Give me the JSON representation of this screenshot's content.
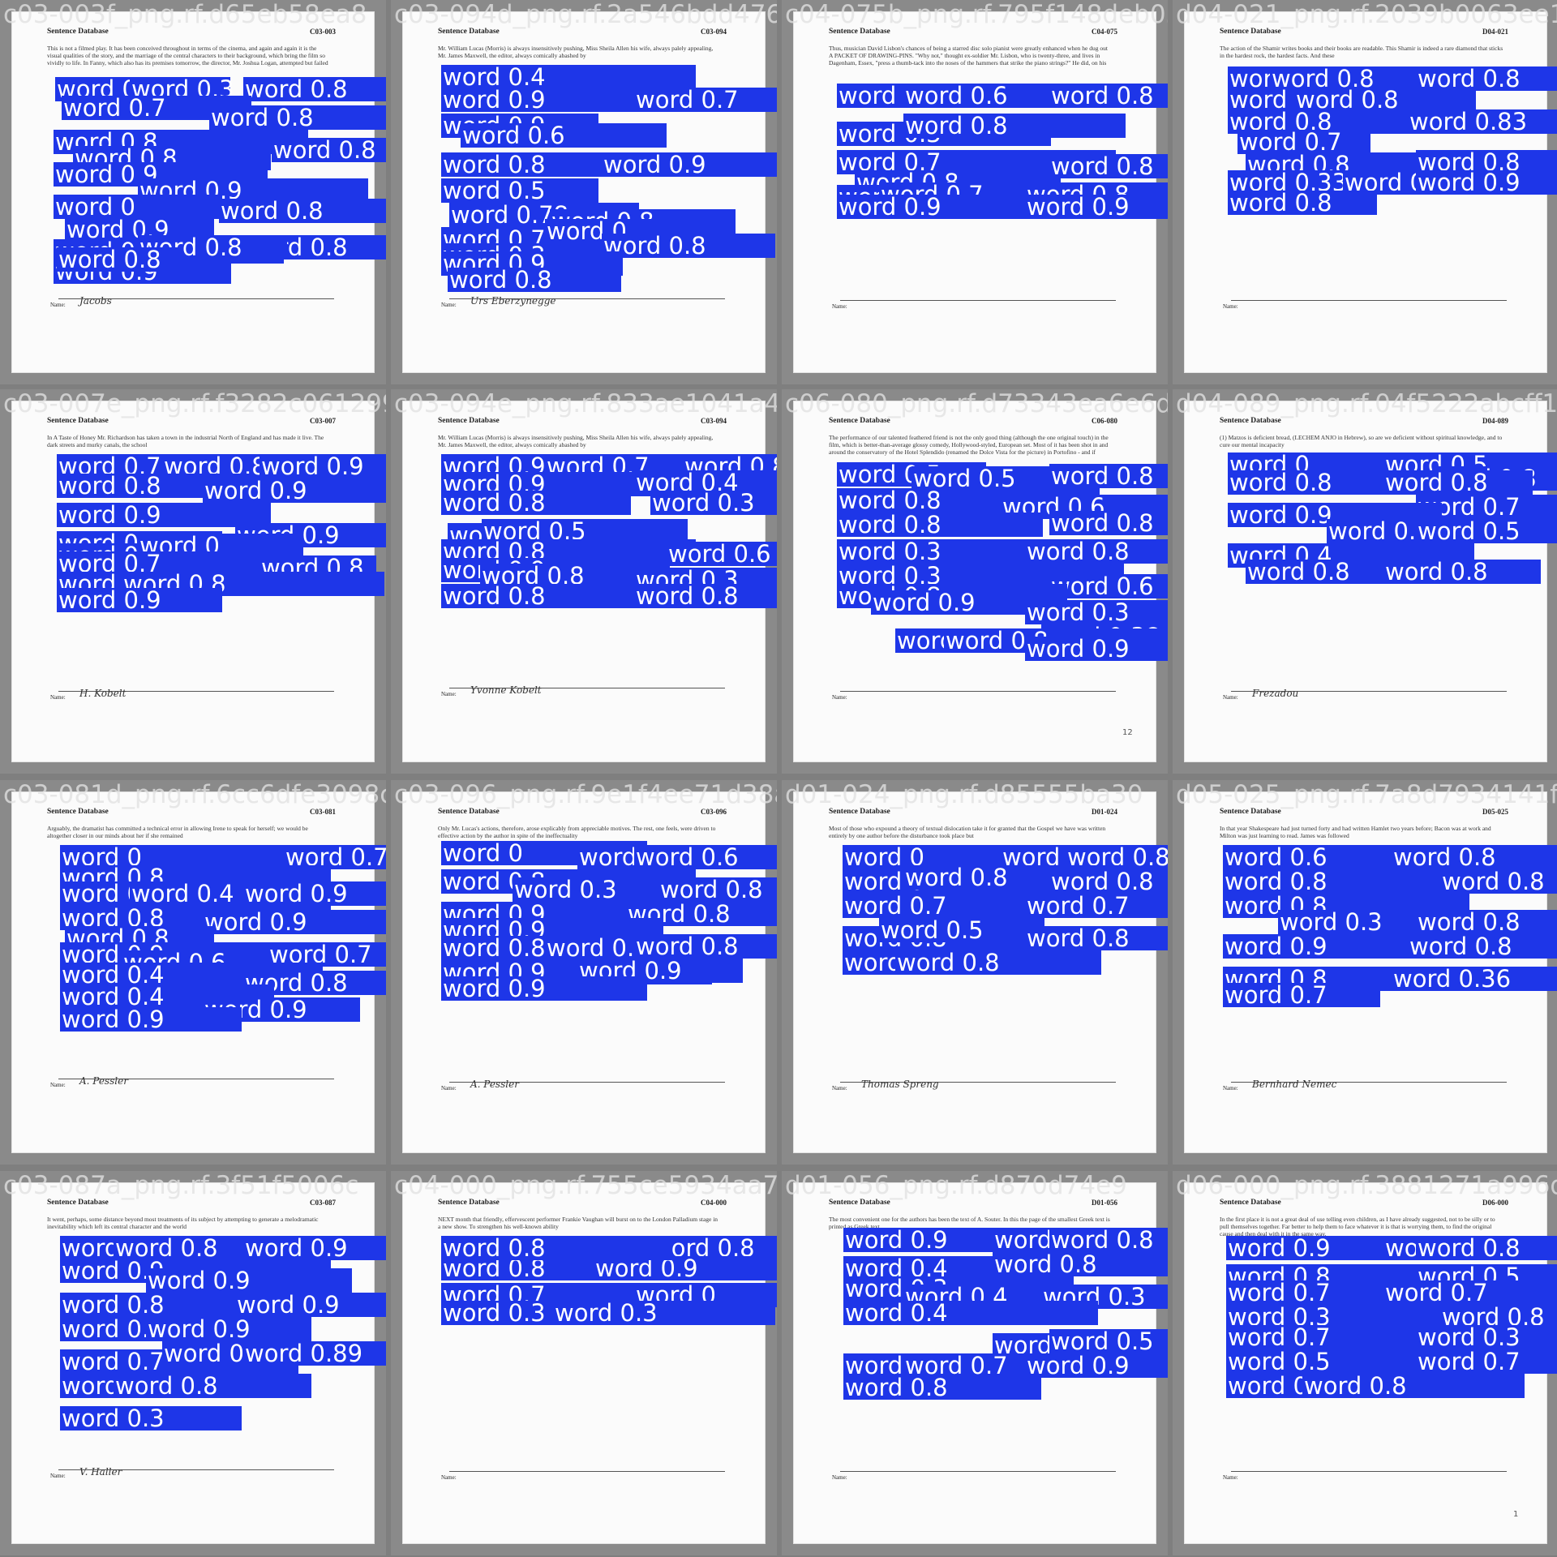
{
  "tiles": [
    {
      "filename": "c03-003f_png.rf.d65eb58ea8",
      "header": "Sentence Database",
      "code": "C03-003",
      "prompt": "This is not a filmed play. It has been conceived throughout in terms of the cinema, and again and again it is the visual qualities of the story, and the marriage of the central characters to their background, which bring the film so vividly to life. In Fanny, which also has its premises tomorrow, the director, Mr. Joshua Logan, attempted but failed",
      "name_label": "Name:",
      "signature": "Jacobs",
      "labels": [
        "word 0.8",
        "word 0.3",
        "word 0.8",
        "word 0.7",
        "word 0.8",
        "word 0.8",
        "word 0.8",
        "word 0.8",
        "word 0.9",
        "word 0.9",
        "word 0",
        "word 0.8",
        "word 0.9",
        "word 0.8",
        "word 0.9",
        "word 0.8",
        "word 0.9",
        "word 0.8"
      ]
    },
    {
      "filename": "c03-094d_png.rf.2a546bdd47667fe",
      "header": "Sentence Database",
      "code": "C03-094",
      "prompt": "Mr. William Lucas (Morris) is always insensitively pushing, Miss Sheila Allen his wife, always palely appealing, Mr. James Maxwell, the editor, always comically abashed by",
      "name_label": "Name:",
      "signature": "Urs Eberzynegge",
      "labels": [
        "word 0.4",
        "word 0.9",
        "word 0.7",
        "word 0.9",
        "word 0.6",
        "word 0.8",
        "word 0.9",
        "word 0.5",
        "word 0.78",
        "word 0.8",
        "word 0.7",
        "word 0",
        "word 0.3",
        "word 0.8",
        "word 0.9",
        "word 0.8"
      ]
    },
    {
      "filename": "c04-075b_png.rf.795f148deb05507d",
      "header": "Sentence Database",
      "code": "C04-075",
      "prompt": "Thus, musician David Lisbon's chances of being a starred disc solo pianist were greatly enhanced when he dug out A PACKET OF DRAWING-PINS. \"Why not,\" thought ex-soldier Mr. Lisbon, who is twenty-three, and lives in Dagenham, Essex, \"press a thumb-tack into the noses of the hammers that strike the piano strings?\" He did, on his piano at home. There weren't enough tacks and he got only the middle hammers",
      "name_label": "Name:",
      "signature": "",
      "labels": [
        "word 0.8",
        "word 0.6",
        "word 0.8",
        "word 0.3",
        "word 0.8",
        "word 0.7",
        "word 0.8",
        "word 0.8",
        "word 0.3",
        "word 0.7",
        "word 0.8",
        "word 0.9",
        "word 0.9"
      ]
    },
    {
      "filename": "d04-021_png.rf.2039b0063ee12",
      "header": "Sentence Database",
      "code": "D04-021",
      "prompt": "The action of the Shamir writes books and their books are readable. This Shamir is indeed a rare diamond that sticks in the hardest rock, the hardest facts. And these",
      "name_label": "Name:",
      "signature": "",
      "labels": [
        "word 0.8",
        "word 0.8",
        "word 0.8",
        "word 0.8",
        "word 0.8",
        "word 0.8",
        "word 0.83",
        "word 0.7",
        "word 0.8",
        "word 0.8",
        "word 0.33",
        "word 0.8",
        "word 0.9",
        "word 0.8"
      ]
    },
    {
      "filename": "c03-007e_png.rf.f3282c061299",
      "header": "Sentence Database",
      "code": "C03-007",
      "prompt": "In A Taste of Honey Mr. Richardson has taken a town in the industrial North of England and has made it live. The dark streets and murky canals, the school",
      "name_label": "Name:",
      "signature": "H. Kobelt",
      "labels": [
        "word 0.7",
        "word 0.8",
        "word 0.9",
        "word 0.8",
        "word 0.9",
        "word 0.9",
        "word 0.3",
        "word 0.9",
        "word 0.9",
        "word 0",
        "word 0.7",
        "word 0.8",
        "word 0.9",
        "word 0.8",
        "word 0.9"
      ]
    },
    {
      "filename": "c03-094e_png.rf.833ae1041a4d6f27",
      "header": "Sentence Database",
      "code": "C03-094",
      "prompt": "Mr. William Lucas (Morris) is always insensitively pushing, Miss Sheila Allen his wife, always palely appealing, Mr. James Maxwell, the editor, always comically abashed by",
      "name_label": "Name:",
      "signature": "Yvonne Kobelt",
      "labels": [
        "word 0.9",
        "word 0.7",
        "word 0.8",
        "word 0.9",
        "word 0.4",
        "word 0.8",
        "word 0.3",
        "word 0.9",
        "word 0.5",
        "word 0.8",
        "word 0.6",
        "word 0.9",
        "word 0.8",
        "word 0.3",
        "word 0.8",
        "word 0.8"
      ]
    },
    {
      "filename": "c06-080_png.rf.d73343ea6e6d",
      "header": "Sentence Database",
      "code": "C06-080",
      "prompt": "The performance of our talented feathered friend is not the only good thing (although the one original touch) in the film, which is better-than-average glossy comedy, Hollywood-styled, European set. Most of it has been shot in and around the conservatory of the Hotel Splendido (renamed the Dolce Vista for the picture) in Portofino - and if there's a better view to be had from a more comfortable vantage point anywhere, I'd like to see it.",
      "name_label": "Name:",
      "signature": "",
      "page_number": "12",
      "labels": [
        "word 0.5",
        "word 0.5",
        "word 0.8",
        "word 0.8",
        "word 0.6",
        "word 0.8",
        "word 0.8",
        "word 0.3",
        "word 0.8",
        "word 0.3",
        "word 0.6",
        "word 0.8",
        "word 0.9",
        "word 0.3",
        "word 0.38",
        "word 0.34",
        "word 0.8",
        "word 0.9"
      ]
    },
    {
      "filename": "d04-089_png.rf.04f5222abcff16",
      "header": "Sentence Database",
      "code": "D04-089",
      "prompt": "(1) Matzos is deficient bread, (LECHEM ANJO in Hebrew), so are we deficient without spiritual knowledge, and to cure our mental incapacity",
      "name_label": "Name:",
      "signature": "Frezadou",
      "labels": [
        "word 0",
        "word 0.5",
        "word 0.8",
        "word 0.8",
        "word 0.8",
        "word 0.7",
        "word 0.9",
        "word 0.3",
        "word 0.5",
        "word 0.4",
        "word 0.8",
        "word 0.8"
      ]
    },
    {
      "filename": "c03-081d_png.rf.6cc6dfe3098c",
      "header": "Sentence Database",
      "code": "C03-081",
      "prompt": "Arguably, the dramatist has committed a technical error in allowing Irene to speak for herself; we would be altogether closer in our minds about her if she remained",
      "name_label": "Name:",
      "signature": "A. Pessler",
      "labels": [
        "word 0",
        "word 0.7",
        "word 0.8",
        "word 0.8",
        "word 0.4",
        "word 0.9",
        "word 0.8",
        "word 0.9",
        "word 0.8",
        "word 0.9",
        "word 0.6",
        "word 0.7",
        "word 0.4",
        "word 0.8",
        "word 0.4",
        "word 0.9",
        "word 0.9"
      ]
    },
    {
      "filename": "c03-096_png.rf.9e1f4ee71d38a0",
      "header": "Sentence Database",
      "code": "C03-096",
      "prompt": "Only Mr. Lucas's actions, therefore, arose explicably from appreciable motives. The rest, one feels, were driven to effective action by the author in spite of the ineffectuality",
      "name_label": "Name:",
      "signature": "A. Pessler",
      "labels": [
        "word 0",
        "word 0.3",
        "word 0.6",
        "word 0.8",
        "word 0.3",
        "word 0.8",
        "word 0.9",
        "word 0.8",
        "word 0.9",
        "word 0.8",
        "word 0.8",
        "word 0.8",
        "word 0.9",
        "word 0.9",
        "word 0.9"
      ]
    },
    {
      "filename": "d01-024_png.rf.d85555ba30",
      "header": "Sentence Database",
      "code": "D01-024",
      "prompt": "Most of those who expound a theory of textual dislocation take it for granted that the Gospel we have was written entirely by one author before the disturbance took place but",
      "name_label": "Name:",
      "signature": "Thomas Spreng",
      "labels": [
        "word 0",
        "word 0.7",
        "word 0.8",
        "word 0.4",
        "word 0.8",
        "word 0.8",
        "word 0.7",
        "word 0.7",
        "word 0.8",
        "word 0.5",
        "word 0.8",
        "word 0.8",
        "word 0.8"
      ]
    },
    {
      "filename": "d05-025_png.rf.7a8d7934141fe71",
      "header": "Sentence Database",
      "code": "D05-025",
      "prompt": "In that year Shakespeare had just turned forty and had written Hamlet two years before; Bacon was at work and Milton was just learning to read. James was followed",
      "name_label": "Name:",
      "signature": "Bernhard Nemec",
      "labels": [
        "word 0.6",
        "word 0.8",
        "word 0.8",
        "word 0.8",
        "word 0.8",
        "word 0.3",
        "word 0.8",
        "word 0.9",
        "word 0.8",
        "word 0.8",
        "word 0.36",
        "word 0.7"
      ]
    },
    {
      "filename": "c03-087a_png.rf.3f51f5006c",
      "header": "Sentence Database",
      "code": "C03-087",
      "prompt": "It went, perhaps, some distance beyond most treatments of its subject by attempting to generate a melodramatic inevitability which left its central character and the world",
      "name_label": "Name:",
      "signature": "V. Haller",
      "labels": [
        "word 0.6",
        "word 0.8",
        "word 0.9",
        "word 0.9",
        "word 0.9",
        "word 0.8",
        "word 0.9",
        "word 0.4",
        "word 0.9",
        "word 0.7",
        "word 0.8",
        "word 0.89",
        "word 0.8",
        "word 0.8",
        "word 0.3"
      ]
    },
    {
      "filename": "c04-000_png.rf.755ce5934aa7",
      "header": "Sentence Database",
      "code": "C04-000",
      "prompt": "NEXT month that friendly, effervescent performer Frankie Vaughan will burst on to the London Palladium stage in a new show. To strengthen his well-known ability",
      "name_label": "Name:",
      "signature": "",
      "labels": [
        "word 0.8",
        "word 0.8",
        "word 0.8",
        "word 0.8",
        "word 0.9",
        "word 0.7",
        "word 0",
        "word 0.3",
        "word 0.3",
        "word 0.8"
      ]
    },
    {
      "filename": "d01-056_png.rf.d870d74e9",
      "header": "Sentence Database",
      "code": "D01-056",
      "prompt": "The most convenient one for the authors has been the text of A. Souter. In this the page of the smallest Greek text is printed as Greek text",
      "name_label": "Name:",
      "signature": "",
      "labels": [
        "word 0.9",
        "word 0.8",
        "word 0.8",
        "word 0.4",
        "word 0.8",
        "word 0.3",
        "word 0.4",
        "word 0.3",
        "word 0.4",
        "word 0.9",
        "word 0.5",
        "word 0.4",
        "word 0.7",
        "word 0.9",
        "word 0.8"
      ]
    },
    {
      "filename": "d06-000_png.rf.3881271a996d9",
      "header": "Sentence Database",
      "code": "D06-000",
      "prompt": "In the first place it is not a great deal of use telling even children, as I have already suggested, not to be silly or to pull themselves together. Far better to help them to face whatever it is that is worrying them, to find the original cause and then deal with it in the same way.",
      "name_label": "Name:",
      "signature": "",
      "page_number": "1",
      "labels": [
        "word 0.9",
        "word 0.9",
        "word 0.8",
        "word 0.8",
        "word 0.5",
        "word 0.7",
        "word 0.7",
        "word 0.3",
        "word 0.8",
        "word 0.7",
        "word 0.3",
        "word 0.5",
        "word 0.7",
        "word 0.8",
        "word 0.8"
      ]
    }
  ]
}
